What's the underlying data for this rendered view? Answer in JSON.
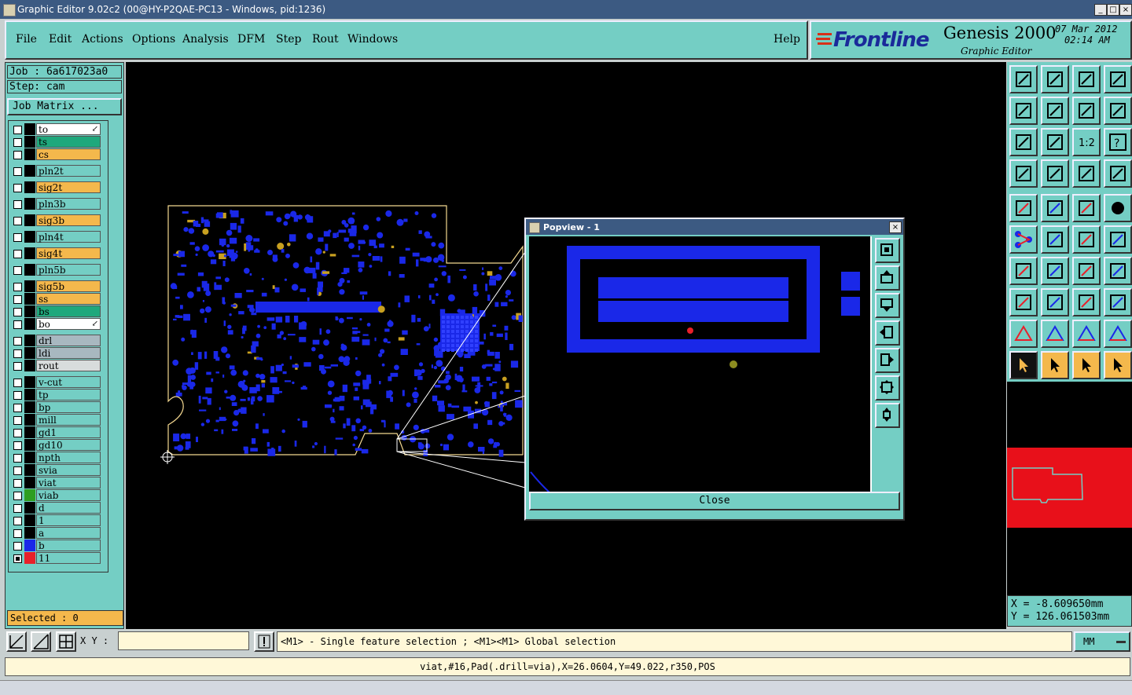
{
  "window": {
    "title": "Graphic Editor 9.02c2 (00@HY-P2QAE-PC13 - Windows, pid:1236)",
    "buttons": [
      "minimize",
      "maximize",
      "close"
    ]
  },
  "menu": {
    "items": [
      "File",
      "Edit",
      "Actions",
      "Options",
      "Analysis",
      "DFM",
      "Step",
      "Rout",
      "Windows"
    ],
    "help": "Help"
  },
  "brand": {
    "logo": "Frontline",
    "product": "Genesis 2000",
    "subtitle": "Graphic Editor",
    "date": "07 Mar 2012",
    "time": "02:14 AM"
  },
  "job": {
    "job_line": "Job : 6a617023a0",
    "step_line": "Step: cam",
    "matrix_button": "Job Matrix ...",
    "selected": "Selected : 0"
  },
  "layers": [
    {
      "name": "to",
      "swatch": "#000000",
      "bg": "#ffffff",
      "arrow": true
    },
    {
      "name": "ts",
      "swatch": "#000000",
      "bg": "#1fa87c"
    },
    {
      "name": "cs",
      "swatch": "#000000",
      "bg": "#f4b84c"
    },
    {
      "name": "pln2t",
      "swatch": "#000000",
      "bg": "#74cec4"
    },
    {
      "name": "sig2t",
      "swatch": "#000000",
      "bg": "#f4b84c"
    },
    {
      "name": "pln3b",
      "swatch": "#000000",
      "bg": "#74cec4"
    },
    {
      "name": "sig3b",
      "swatch": "#000000",
      "bg": "#f4b84c"
    },
    {
      "name": "pln4t",
      "swatch": "#000000",
      "bg": "#74cec4"
    },
    {
      "name": "sig4t",
      "swatch": "#000000",
      "bg": "#f4b84c"
    },
    {
      "name": "pln5b",
      "swatch": "#000000",
      "bg": "#74cec4"
    },
    {
      "name": "sig5b",
      "swatch": "#000000",
      "bg": "#f4b84c"
    },
    {
      "name": "ss",
      "swatch": "#000000",
      "bg": "#f4b84c"
    },
    {
      "name": "bs",
      "swatch": "#000000",
      "bg": "#1fa87c"
    },
    {
      "name": "bo",
      "swatch": "#000000",
      "bg": "#ffffff",
      "arrow": true
    },
    {
      "name": "drl",
      "swatch": "#000000",
      "bg": "#a8b8c0"
    },
    {
      "name": "ldi",
      "swatch": "#000000",
      "bg": "#a8b8c0"
    },
    {
      "name": "rout",
      "swatch": "#000000",
      "bg": "#d8dcdc"
    },
    {
      "name": "v-cut",
      "swatch": "#000000",
      "bg": "#74cec4"
    },
    {
      "name": "tp",
      "swatch": "#000000",
      "bg": "#74cec4"
    },
    {
      "name": "bp",
      "swatch": "#000000",
      "bg": "#74cec4"
    },
    {
      "name": "mill",
      "swatch": "#000000",
      "bg": "#74cec4"
    },
    {
      "name": "gd1",
      "swatch": "#000000",
      "bg": "#74cec4"
    },
    {
      "name": "gd10",
      "swatch": "#000000",
      "bg": "#74cec4"
    },
    {
      "name": "npth",
      "swatch": "#000000",
      "bg": "#74cec4"
    },
    {
      "name": "svia",
      "swatch": "#000000",
      "bg": "#74cec4"
    },
    {
      "name": "viat",
      "swatch": "#000000",
      "bg": "#74cec4"
    },
    {
      "name": "viab",
      "swatch": "#2e9e20",
      "bg": "#74cec4"
    },
    {
      "name": "d",
      "swatch": "#000000",
      "bg": "#74cec4"
    },
    {
      "name": "1",
      "swatch": "#000000",
      "bg": "#74cec4"
    },
    {
      "name": "a",
      "swatch": "#000000",
      "bg": "#74cec4"
    },
    {
      "name": "b",
      "swatch": "#1a28e8",
      "bg": "#74cec4"
    },
    {
      "name": "11",
      "swatch": "#e8202a",
      "bg": "#74cec4",
      "checked": true
    }
  ],
  "popview": {
    "title": "Popview - 1",
    "close_label": "Close"
  },
  "coords": {
    "x": "X = -8.609650mm",
    "y": "Y = 126.061503mm"
  },
  "bottom": {
    "xy_label": "X Y :",
    "xy_value": "",
    "hint": "<M1> - Single feature selection ; <M1><M1> Global selection",
    "units": "MM"
  },
  "status": "viat,#16,Pad(.drill=via),X=26.0604,Y=49.022,r350,POS",
  "colors": {
    "panel": "#74cec4",
    "feature": "#1a28e8",
    "profile": "#f4d890",
    "highlight": "#f4b84c",
    "titlebar": "#3c5a82"
  }
}
